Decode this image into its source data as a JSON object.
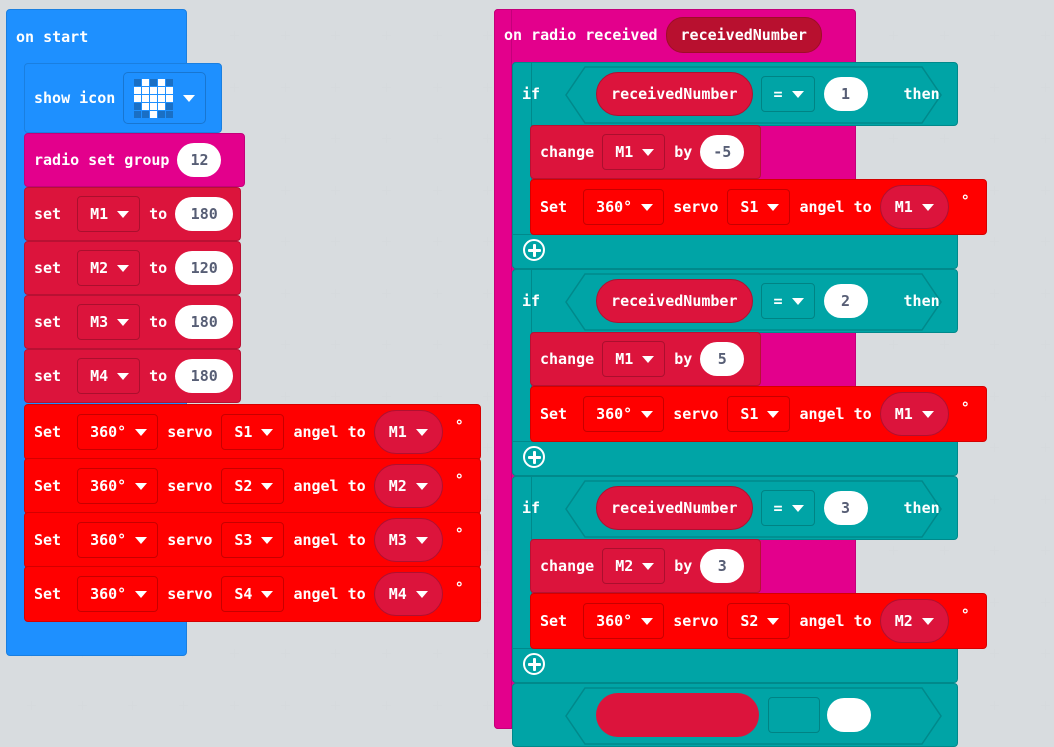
{
  "workspace": {
    "accent_colors": {
      "basic": "#1e90ff",
      "radio": "#e3008c",
      "variables": "#dc143c",
      "servo": "#ff0000",
      "logic": "#00a4a6"
    }
  },
  "on_start": {
    "label": "on start",
    "show_icon": {
      "label": "show icon",
      "icon": "heart-icon",
      "leds": [
        [
          0,
          1,
          0,
          1,
          0
        ],
        [
          1,
          1,
          1,
          1,
          1
        ],
        [
          1,
          1,
          1,
          1,
          1
        ],
        [
          0,
          1,
          1,
          1,
          0
        ],
        [
          0,
          0,
          1,
          0,
          0
        ]
      ]
    },
    "radio_set_group": {
      "label": "radio set group",
      "value": "12"
    },
    "sets": [
      {
        "label": "set",
        "var": "M1",
        "to": "to",
        "value": "180"
      },
      {
        "label": "set",
        "var": "M2",
        "to": "to",
        "value": "120"
      },
      {
        "label": "set",
        "var": "M3",
        "to": "to",
        "value": "180"
      },
      {
        "label": "set",
        "var": "M4",
        "to": "to",
        "value": "180"
      }
    ],
    "servos": [
      {
        "label": "Set",
        "mode": "360°",
        "servo_label": "servo",
        "servo": "S1",
        "angle_label": "angel to",
        "var": "M1",
        "unit": "°"
      },
      {
        "label": "Set",
        "mode": "360°",
        "servo_label": "servo",
        "servo": "S2",
        "angle_label": "angel to",
        "var": "M2",
        "unit": "°"
      },
      {
        "label": "Set",
        "mode": "360°",
        "servo_label": "servo",
        "servo": "S3",
        "angle_label": "angel to",
        "var": "M3",
        "unit": "°"
      },
      {
        "label": "Set",
        "mode": "360°",
        "servo_label": "servo",
        "servo": "S4",
        "angle_label": "angel to",
        "var": "M4",
        "unit": "°"
      }
    ]
  },
  "on_radio": {
    "label": "on radio received",
    "param": "receivedNumber",
    "ifs": [
      {
        "if": "if",
        "var": "receivedNumber",
        "op": "=",
        "value": "1",
        "then": "then",
        "change": {
          "label": "change",
          "var": "M1",
          "by": "by",
          "value": "-5"
        },
        "servo": {
          "label": "Set",
          "mode": "360°",
          "servo_label": "servo",
          "servo": "S1",
          "angle_label": "angel to",
          "var": "M1",
          "unit": "°"
        }
      },
      {
        "if": "if",
        "var": "receivedNumber",
        "op": "=",
        "value": "2",
        "then": "then",
        "change": {
          "label": "change",
          "var": "M1",
          "by": "by",
          "value": "5"
        },
        "servo": {
          "label": "Set",
          "mode": "360°",
          "servo_label": "servo",
          "servo": "S1",
          "angle_label": "angel to",
          "var": "M1",
          "unit": "°"
        }
      },
      {
        "if": "if",
        "var": "receivedNumber",
        "op": "=",
        "value": "3",
        "then": "then",
        "change": {
          "label": "change",
          "var": "M2",
          "by": "by",
          "value": "3"
        },
        "servo": {
          "label": "Set",
          "mode": "360°",
          "servo_label": "servo",
          "servo": "S2",
          "angle_label": "angel to",
          "var": "M2",
          "unit": "°"
        }
      }
    ]
  }
}
